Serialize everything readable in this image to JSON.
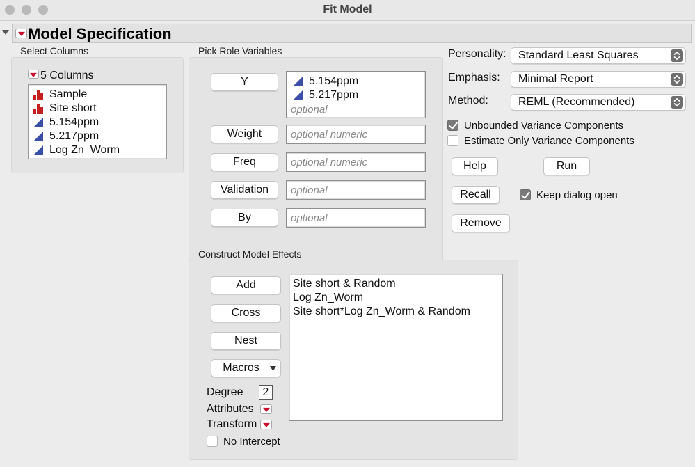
{
  "window": {
    "title": "Fit Model"
  },
  "spec": {
    "title": "Model Specification"
  },
  "select_columns": {
    "label": "Select Columns",
    "count_label": "5 Columns",
    "items": [
      {
        "label": "Sample",
        "icon": "nominal-bar-icon"
      },
      {
        "label": "Site short",
        "icon": "nominal-bar-icon"
      },
      {
        "label": "5.154ppm",
        "icon": "continuous-triangle-icon"
      },
      {
        "label": "5.217ppm",
        "icon": "continuous-triangle-icon"
      },
      {
        "label": "Log Zn_Worm",
        "icon": "continuous-triangle-icon"
      }
    ]
  },
  "roles": {
    "label": "Pick Role Variables",
    "y_button": "Y",
    "y_items": [
      "5.154ppm",
      "5.217ppm"
    ],
    "y_placeholder": "optional",
    "weight_button": "Weight",
    "weight_placeholder": "optional numeric",
    "freq_button": "Freq",
    "freq_placeholder": "optional numeric",
    "validation_button": "Validation",
    "validation_placeholder": "optional",
    "by_button": "By",
    "by_placeholder": "optional"
  },
  "options": {
    "personality_label": "Personality:",
    "personality_value": "Standard Least Squares",
    "emphasis_label": "Emphasis:",
    "emphasis_value": "Minimal Report",
    "method_label": "Method:",
    "method_value": "REML (Recommended)",
    "unbounded_label": "Unbounded Variance Components",
    "unbounded_checked": true,
    "estimate_only_label": "Estimate Only Variance Components",
    "estimate_only_checked": false,
    "help_button": "Help",
    "run_button": "Run",
    "recall_button": "Recall",
    "keep_open_label": "Keep dialog open",
    "keep_open_checked": true,
    "remove_button": "Remove"
  },
  "construct": {
    "label": "Construct Model Effects",
    "add_button": "Add",
    "cross_button": "Cross",
    "nest_button": "Nest",
    "macros_button": "Macros",
    "degree_label": "Degree",
    "degree_value": "2",
    "attributes_label": "Attributes",
    "transform_label": "Transform",
    "no_intercept_label": "No Intercept",
    "no_intercept_checked": false,
    "effects": [
      "Site short & Random",
      "Log Zn_Worm",
      "Site short*Log Zn_Worm & Random"
    ]
  },
  "colors": {
    "red_triangle": "#c8102e",
    "continuous_icon": "#3b4fa8",
    "nominal_icon": "#c42020"
  }
}
